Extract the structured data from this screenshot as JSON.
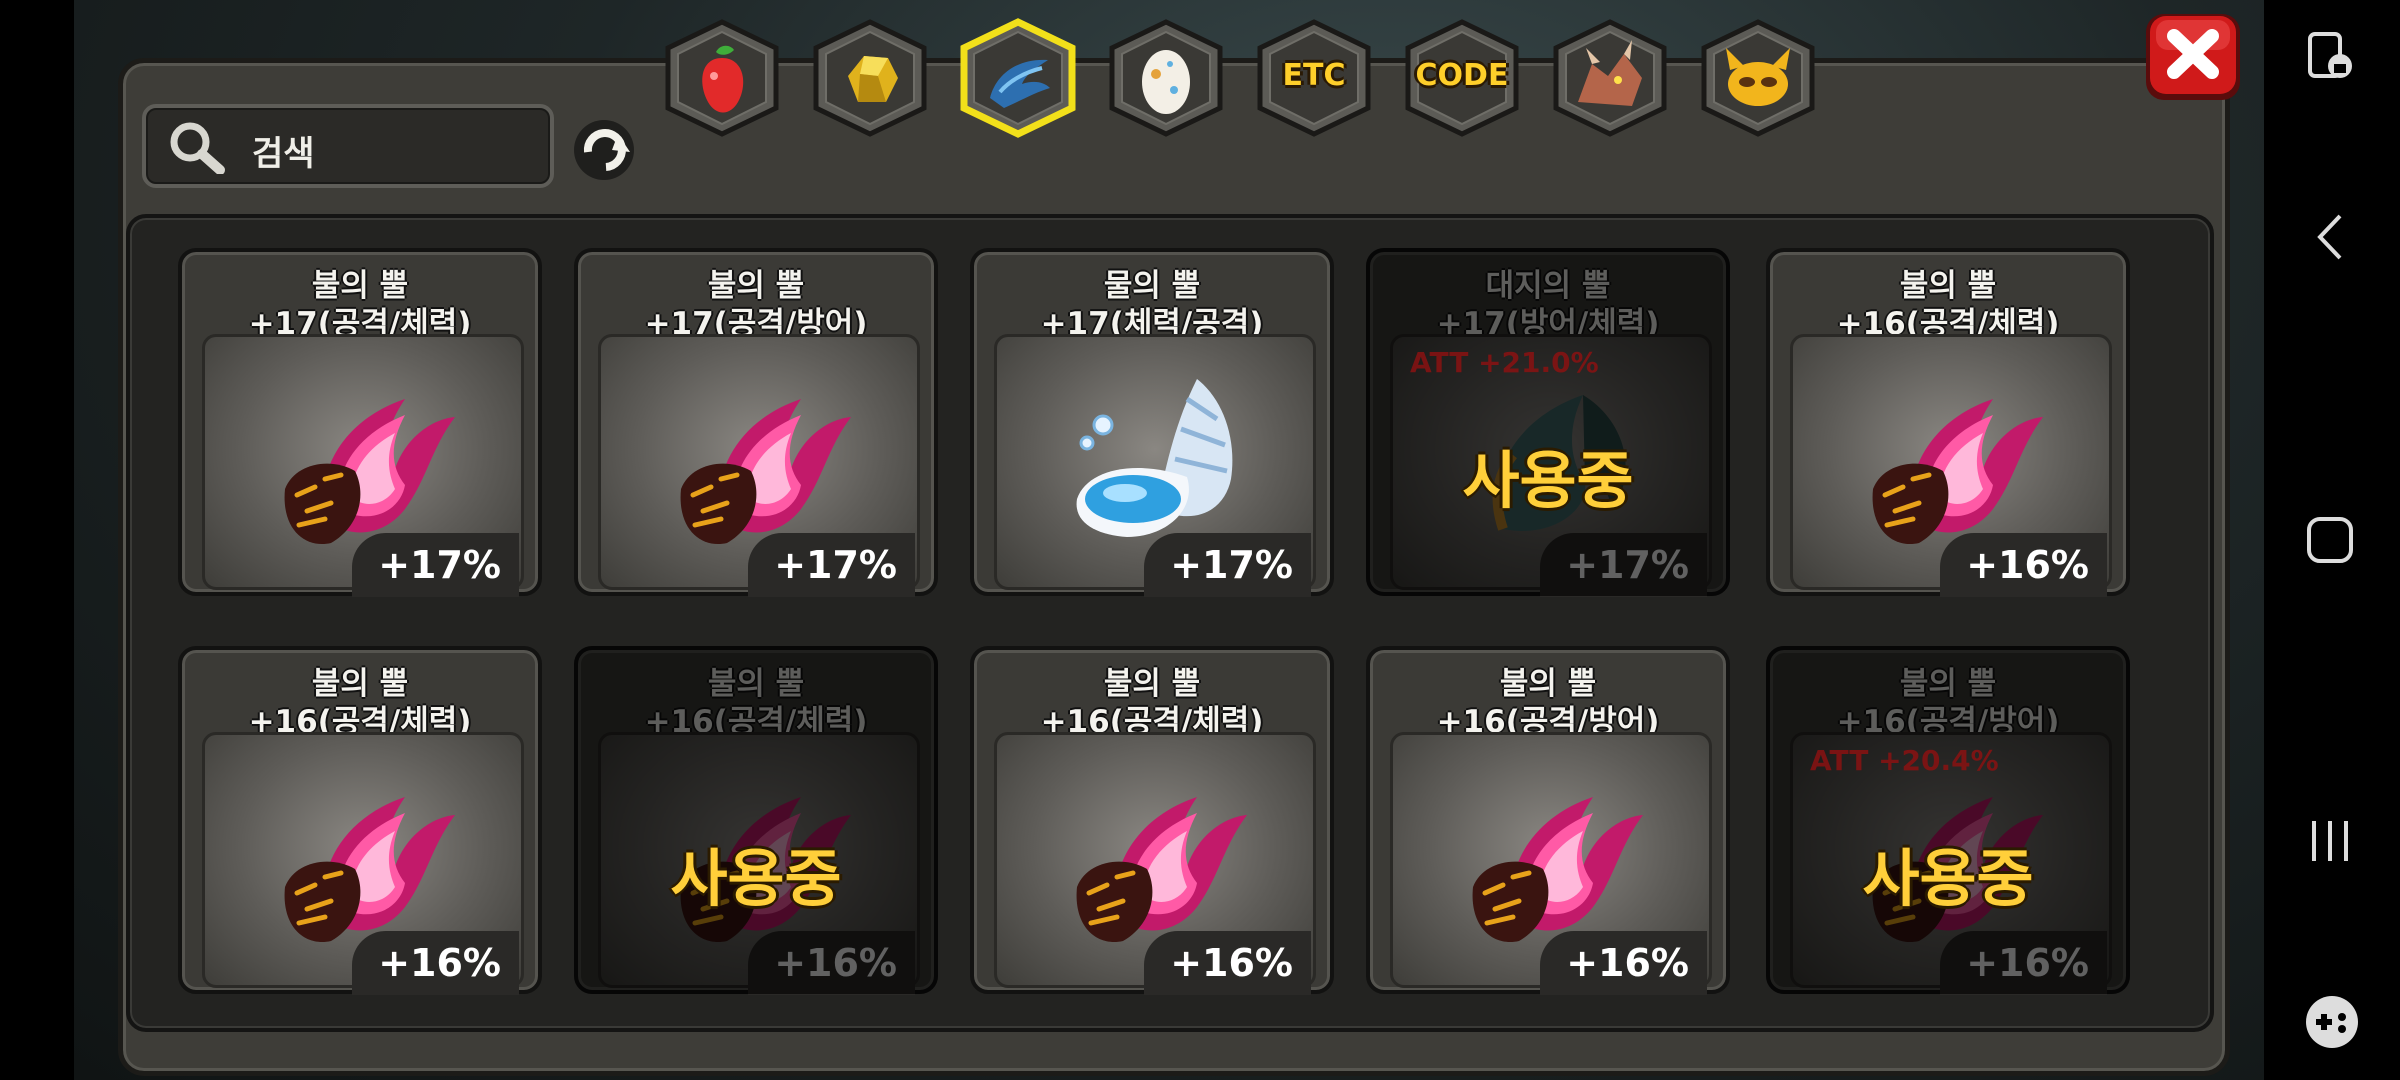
{
  "search": {
    "placeholder": "검색"
  },
  "tabs": [
    {
      "id": "fruit",
      "icon": "red-fruit-icon",
      "label": "",
      "selected": false
    },
    {
      "id": "ore",
      "icon": "gold-ore-icon",
      "label": "",
      "selected": false
    },
    {
      "id": "horn",
      "icon": "blue-horn-icon",
      "label": "",
      "selected": true
    },
    {
      "id": "egg",
      "icon": "egg-icon",
      "label": "",
      "selected": false
    },
    {
      "id": "etc",
      "icon": "",
      "label": "ETC",
      "selected": false
    },
    {
      "id": "code",
      "icon": "",
      "label": "CODE",
      "selected": false
    },
    {
      "id": "dragon",
      "icon": "dragon-head-icon",
      "label": "",
      "selected": false
    },
    {
      "id": "mask",
      "icon": "gold-mask-icon",
      "label": "",
      "selected": false
    }
  ],
  "items": [
    {
      "name": "불의 뿔",
      "stat": "+17(공격/체력)",
      "percent": "+17%",
      "type": "fire",
      "in_use": false,
      "att": ""
    },
    {
      "name": "불의 뿔",
      "stat": "+17(공격/방어)",
      "percent": "+17%",
      "type": "fire",
      "in_use": false,
      "att": ""
    },
    {
      "name": "물의 뿔",
      "stat": "+17(체력/공격)",
      "percent": "+17%",
      "type": "water",
      "in_use": false,
      "att": ""
    },
    {
      "name": "대지의 뿔",
      "stat": "+17(방어/체력)",
      "percent": "+17%",
      "type": "earth",
      "in_use": true,
      "att": "ATT +21.0%"
    },
    {
      "name": "불의 뿔",
      "stat": "+16(공격/체력)",
      "percent": "+16%",
      "type": "fire",
      "in_use": false,
      "att": ""
    },
    {
      "name": "불의 뿔",
      "stat": "+16(공격/체력)",
      "percent": "+16%",
      "type": "fire",
      "in_use": false,
      "att": ""
    },
    {
      "name": "불의 뿔",
      "stat": "+16(공격/체력)",
      "percent": "+16%",
      "type": "fire",
      "in_use": true,
      "att": ""
    },
    {
      "name": "불의 뿔",
      "stat": "+16(공격/체력)",
      "percent": "+16%",
      "type": "fire",
      "in_use": false,
      "att": ""
    },
    {
      "name": "불의 뿔",
      "stat": "+16(공격/방어)",
      "percent": "+16%",
      "type": "fire",
      "in_use": false,
      "att": ""
    },
    {
      "name": "불의 뿔",
      "stat": "+16(공격/방어)",
      "percent": "+16%",
      "type": "fire",
      "in_use": true,
      "att": "ATT +20.4%"
    }
  ],
  "in_use_label": "사용중",
  "colors": {
    "selected_tab_border": "#f2e01a",
    "in_use_text": "#ffcf3a",
    "close_button": "#d01a1a"
  }
}
